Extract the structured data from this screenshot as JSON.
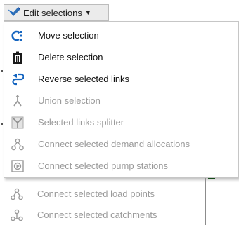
{
  "toolbar": {
    "label": "Edit selections",
    "icon": "edit-selection-icon",
    "dropdown_icon": "caret-down-icon"
  },
  "menu": {
    "items": [
      {
        "label": "Move selection",
        "icon": "move-selection-icon",
        "enabled": true
      },
      {
        "label": "Delete selection",
        "icon": "trash-icon",
        "enabled": true
      },
      {
        "label": "Reverse selected links",
        "icon": "reverse-arrow-icon",
        "enabled": true
      },
      {
        "label": "Union selection",
        "icon": "union-icon",
        "enabled": false
      },
      {
        "label": "Selected links splitter",
        "icon": "splitter-icon",
        "enabled": false
      },
      {
        "label": "Connect selected demand allocations",
        "icon": "connect-nodes-icon",
        "enabled": false
      },
      {
        "label": "Connect selected pump stations",
        "icon": "pump-station-icon",
        "enabled": false
      }
    ]
  },
  "lower_menu": {
    "items": [
      {
        "label": "Connect selected load points",
        "icon": "connect-nodes-icon",
        "enabled": false
      },
      {
        "label": "Connect selected catchments",
        "icon": "catchment-icon",
        "enabled": false
      }
    ]
  },
  "colors": {
    "enabled_text": "#111111",
    "disabled_text": "#9a9a9a",
    "accent_blue": "#1565c0",
    "button_bg": "#ebebeb",
    "menu_border": "#c6c6c6"
  }
}
